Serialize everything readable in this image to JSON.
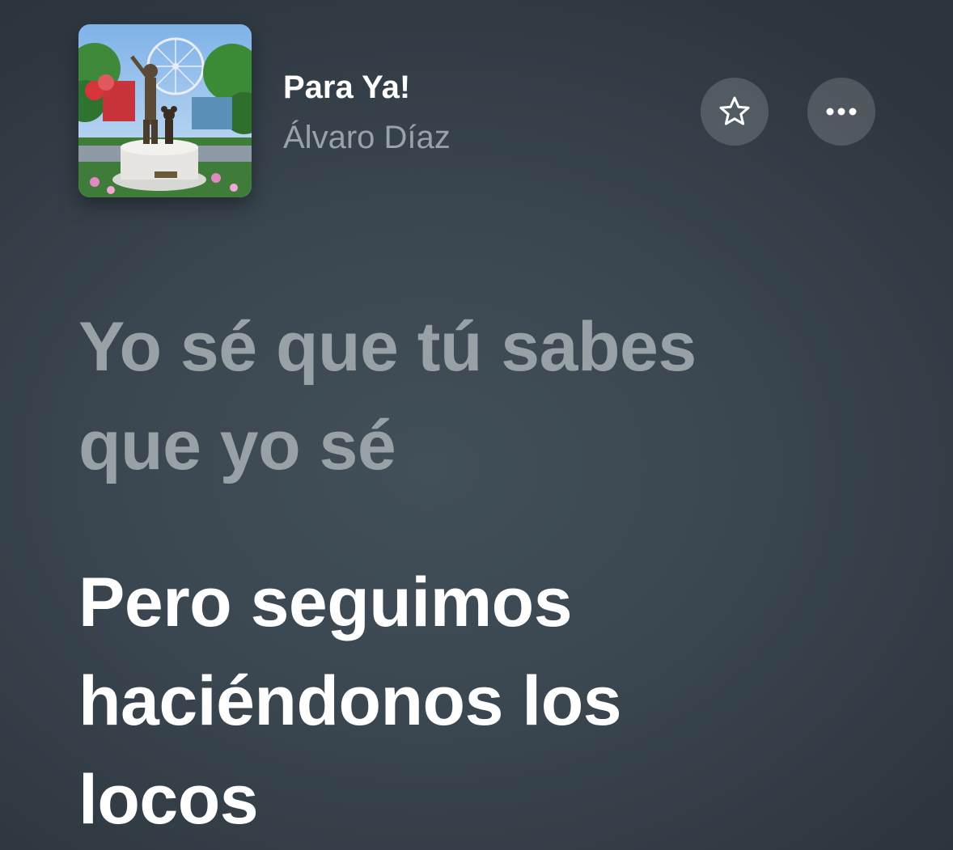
{
  "now_playing": {
    "title": "Para Ya!",
    "artist": "Álvaro Díaz",
    "artwork_icon": "album-artwork-statue"
  },
  "actions": {
    "favorite_icon": "star-outline-icon",
    "more_icon": "ellipsis-icon"
  },
  "lyrics": {
    "previous_line": [
      "Yo sé que tú sabes",
      "que yo sé"
    ],
    "current_line": [
      "Pero seguimos",
      "haciéndonos los",
      "locos"
    ]
  },
  "colors": {
    "background": "#3a4650",
    "current_lyric": "#ffffff",
    "past_lyric": "#97a1a6",
    "artist_text": "#98a2a8"
  }
}
